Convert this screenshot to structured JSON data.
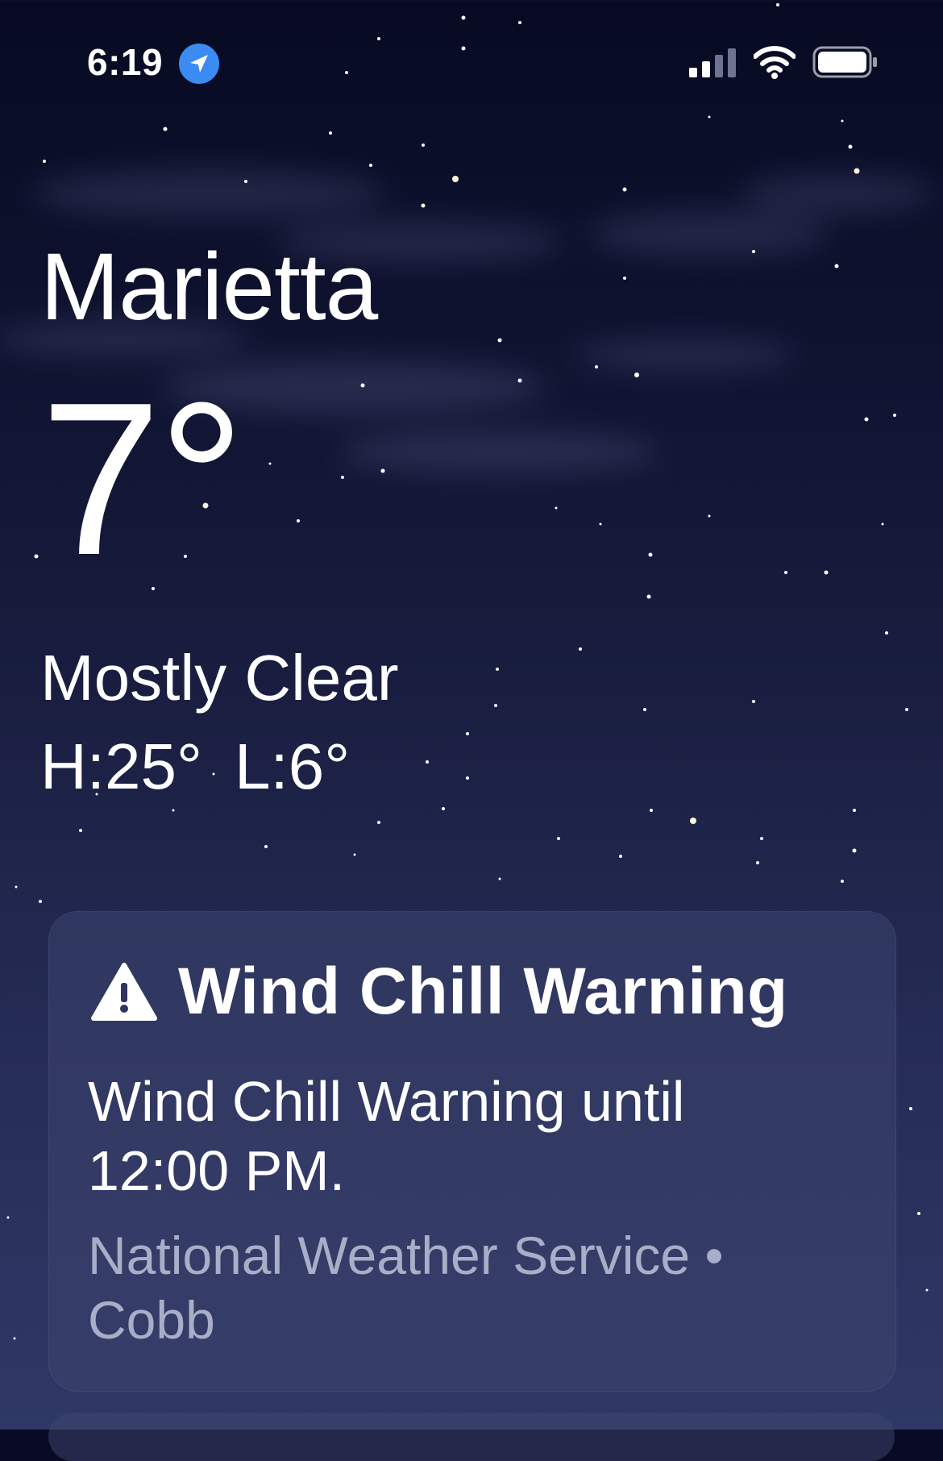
{
  "status_bar": {
    "time": "6:19",
    "location_icon": "location-arrow-icon",
    "signal_icon": "cellular-signal-icon",
    "wifi_icon": "wifi-icon",
    "battery_icon": "battery-icon"
  },
  "weather": {
    "city": "Marietta",
    "temperature": "7°",
    "condition": "Mostly Clear",
    "high": "H:25°",
    "low": "L:6°"
  },
  "alert": {
    "icon": "warning-triangle-icon",
    "title": "Wind Chill Warning",
    "body": "Wind Chill Warning until 12:00 PM.",
    "source": "National Weather Service • Cobb"
  },
  "colors": {
    "location_blue": "#3b8cf2",
    "secondary_text": "#a9aec8"
  }
}
